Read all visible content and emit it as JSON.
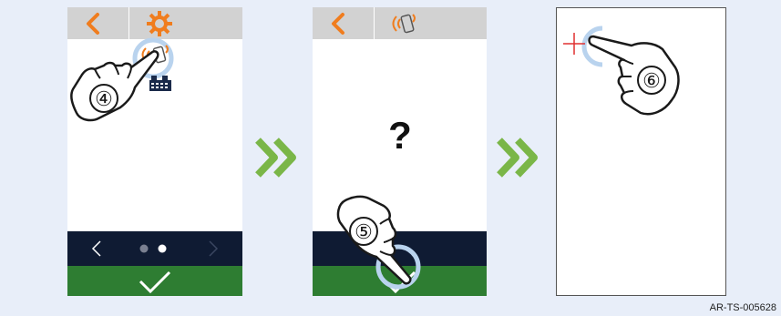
{
  "steps": [
    {
      "panel": "screen-1",
      "number": "④",
      "header_icon": "gear-icon",
      "tap_target": "remote-control-icon",
      "nav_dots": 2,
      "active_dot": 2
    },
    {
      "panel": "screen-2",
      "number": "⑤",
      "header_icon": "remote-control-icon",
      "center_text": "?",
      "tap_target": "confirm-button"
    },
    {
      "panel": "screen-3",
      "number": "⑥",
      "tap_target": "calibration-crosshair"
    }
  ],
  "reference": "AR-TS-005628",
  "colors": {
    "background": "#e8eef9",
    "accent_orange": "#f07d1e",
    "nav_dark": "#0f1b33",
    "confirm_green": "#2e7d32",
    "arrow_green": "#7ab648",
    "tap_ring": "#b9d3ee",
    "crosshair": "#e03030"
  }
}
